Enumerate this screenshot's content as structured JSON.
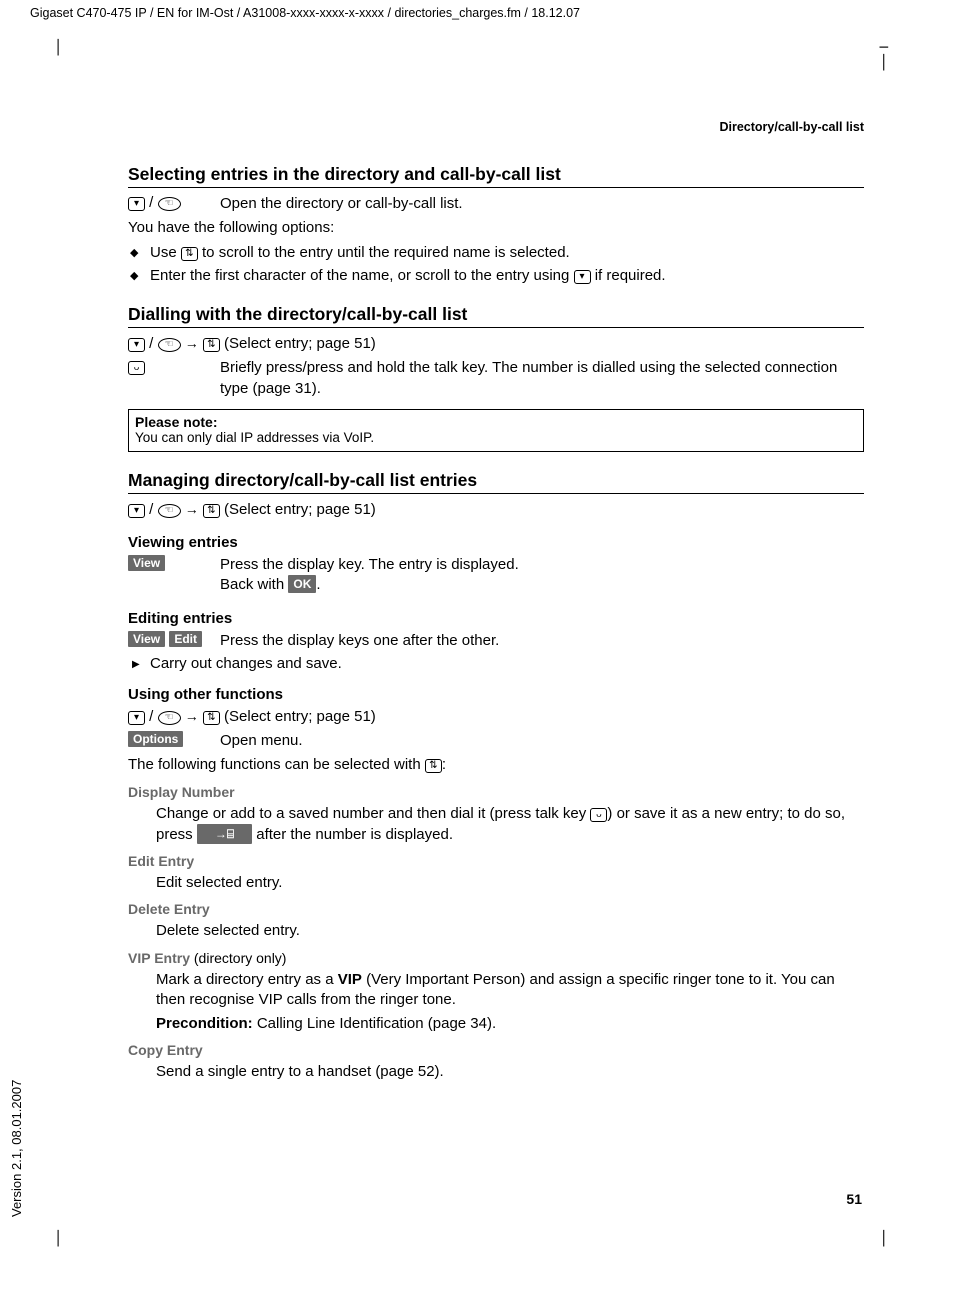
{
  "top_path": "Gigaset C470-475 IP / EN for IM-Ost / A31008-xxxx-xxxx-x-xxxx / directories_charges.fm / 18.12.07",
  "running_head": "Directory/call-by-call list",
  "version_side": "Version 2.1, 08.01.2007",
  "page_number": "51",
  "h2_a": "Selecting entries in the directory and call-by-call list",
  "sel_open": "Open the directory or call-by-call list.",
  "sel_options_intro": "You have the following options:",
  "sel_b1_a": "Use ",
  "sel_b1_b": " to scroll to the entry until the required name is selected.",
  "sel_b2_a": "Enter the first character of the name, or scroll to the entry using ",
  "sel_b2_b": " if required.",
  "h2_b": "Dialling with the directory/call-by-call list",
  "dial_select": " (Select entry; page 51)",
  "dial_desc": "Briefly press/press and hold the talk key. The number is dialled using the selected connection type (page 31).",
  "note_title": "Please note:",
  "note_body": "You can only dial IP addresses via VoIP.",
  "h2_c": "Managing directory/call-by-call list entries",
  "mng_select": " (Select entry; page 51)",
  "h3_view": "Viewing entries",
  "view_key": "View",
  "view_desc": "Press the display key. The entry is displayed.",
  "view_back_a": "Back with ",
  "view_back_b": ".",
  "ok_key": "OK",
  "h3_edit": "Editing entries",
  "edit_key": "Edit",
  "edit_desc": "Press the display keys one after the other.",
  "edit_carry": "Carry out changes and save.",
  "h3_other": "Using other functions",
  "other_select": " (Select entry; page 51)",
  "options_key": "Options",
  "options_open": "Open menu.",
  "other_intro_a": "The following functions can be selected with ",
  "other_intro_b": ":",
  "fn_disp_t": "Display Number",
  "fn_disp_a": "Change or add to a saved number and then dial it (press talk key ",
  "fn_disp_b": ") or save it as a new entry; to do so, press ",
  "fn_disp_c": " after the number is displayed.",
  "save_icon_label": "→⌸",
  "fn_edit_t": "Edit Entry",
  "fn_edit_d": "Edit selected entry.",
  "fn_del_t": "Delete Entry",
  "fn_del_d": "Delete selected entry.",
  "fn_vip_t": "VIP Entry",
  "fn_vip_suffix": " (directory only)",
  "fn_vip_a": "Mark a directory entry as a ",
  "fn_vip_bold": "VIP",
  "fn_vip_b": " (Very Important Person) and assign a specific ringer tone to it. You can then recognise VIP calls from the ringer tone.",
  "fn_vip_pre_bold": "Precondition:",
  "fn_vip_pre": " Calling Line Identification (page 34).",
  "fn_copy_t": "Copy Entry",
  "fn_copy_d": "Send a single entry to a handset (page 52)."
}
